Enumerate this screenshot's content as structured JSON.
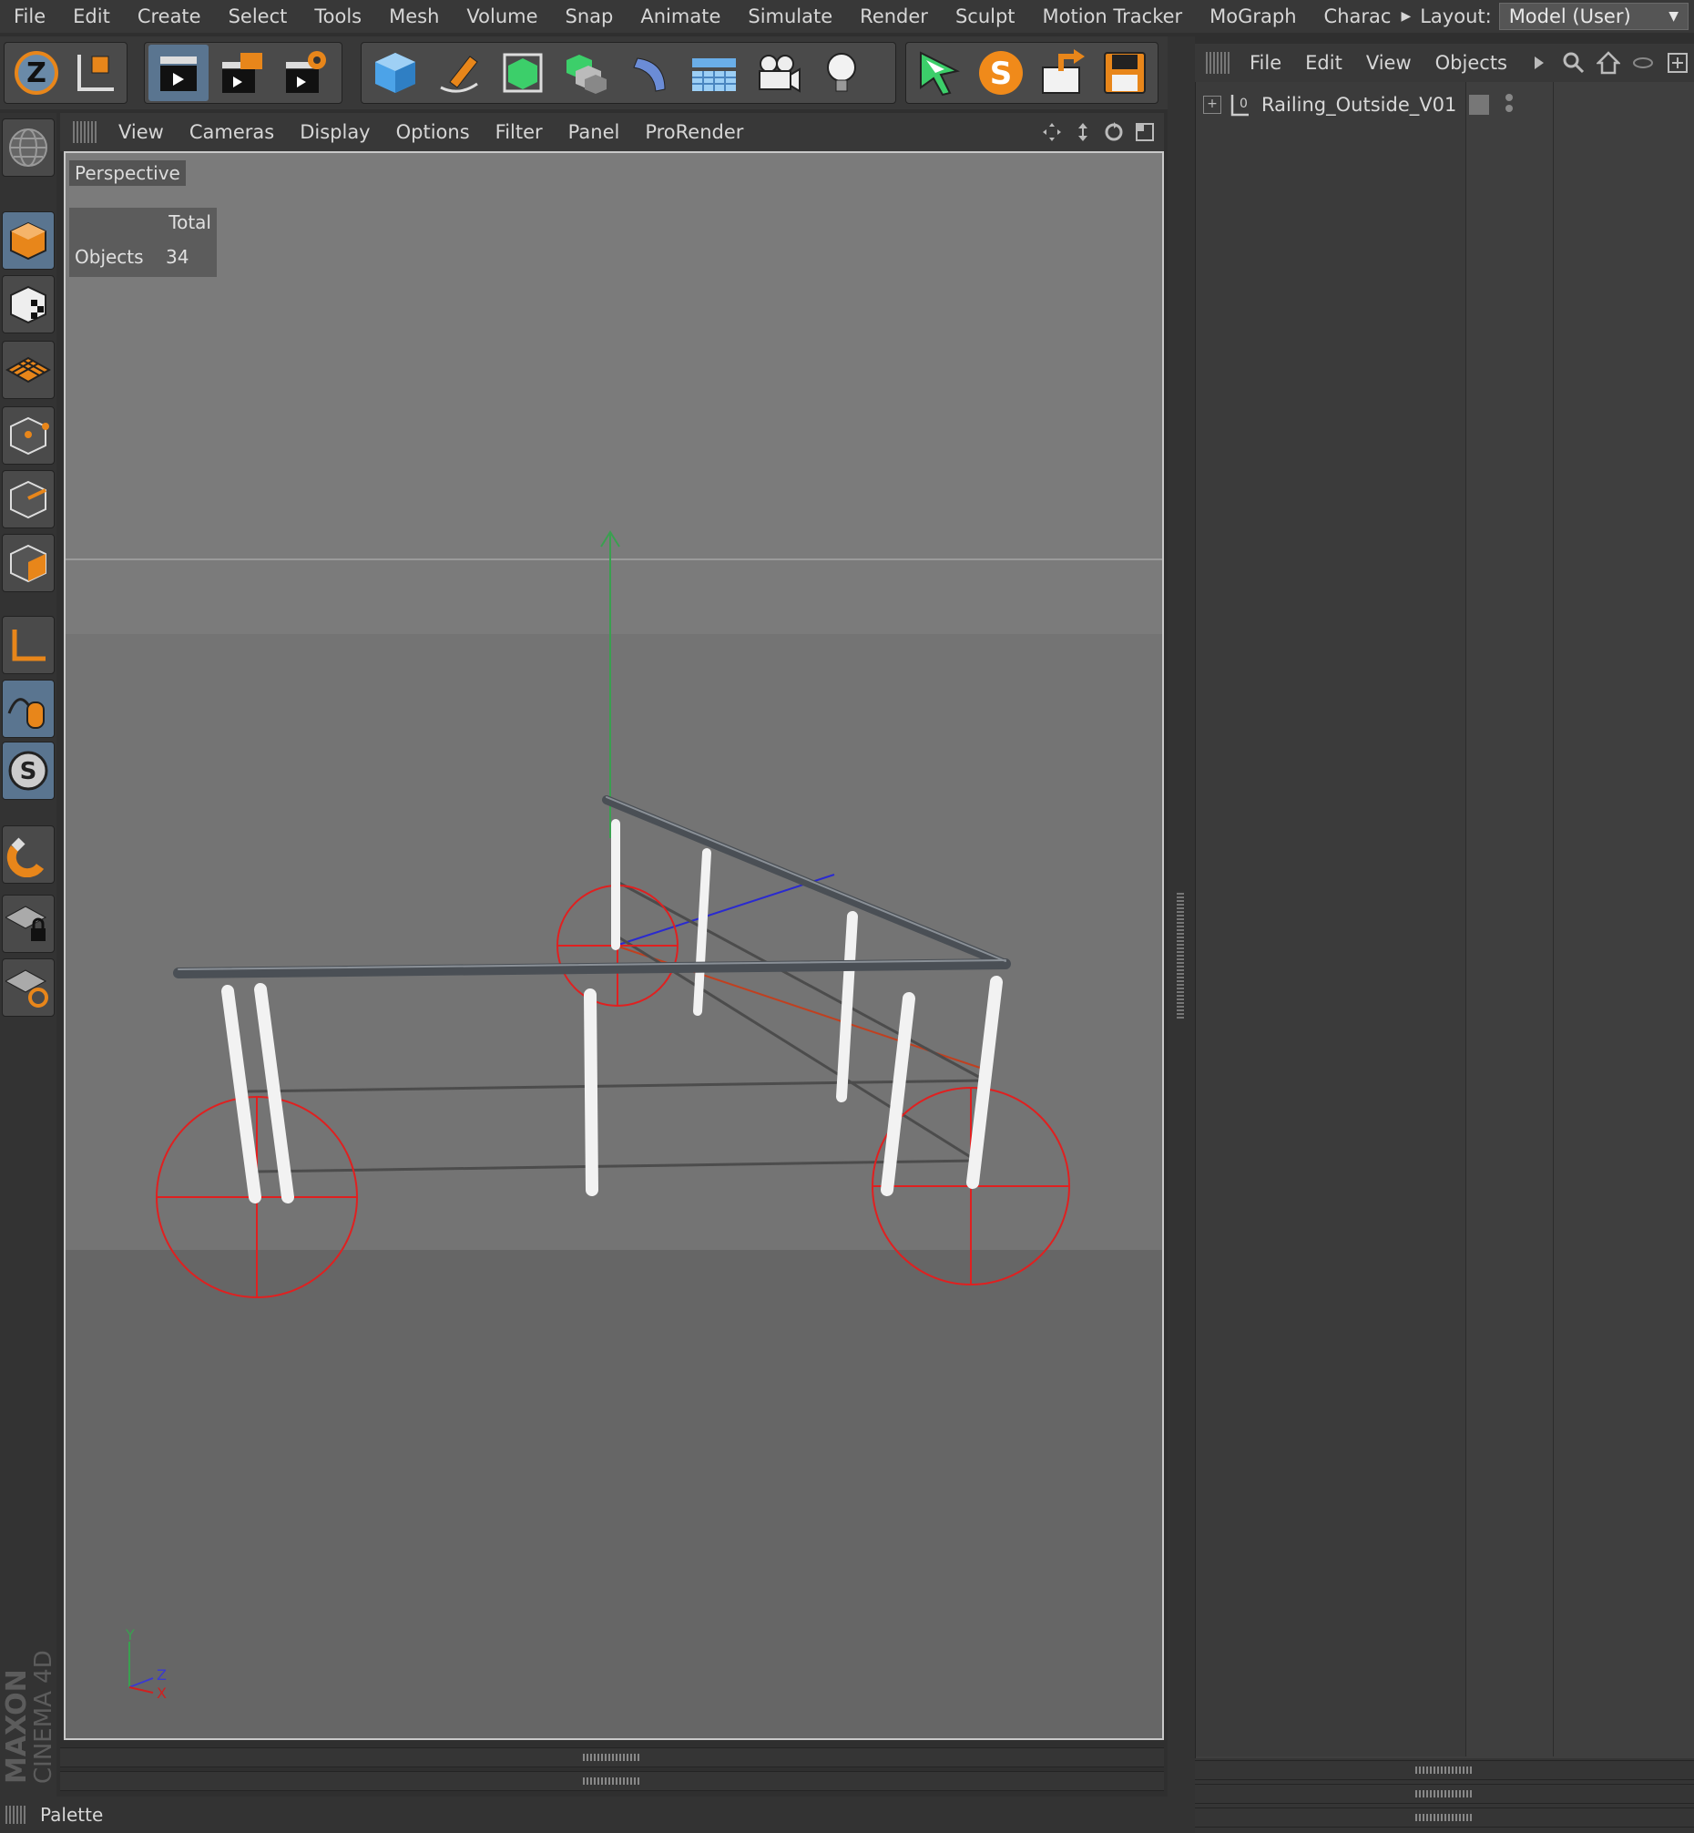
{
  "main_menu": {
    "items": [
      "File",
      "Edit",
      "Create",
      "Select",
      "Tools",
      "Mesh",
      "Volume",
      "Snap",
      "Animate",
      "Simulate",
      "Render",
      "Sculpt",
      "Motion Tracker",
      "MoGraph",
      "Charac"
    ],
    "layout_label": "Layout:",
    "layout_value": "Model (User)"
  },
  "toolbar": {
    "buttons": [
      "undo",
      "live-selection",
      "render-view",
      "render-to-picture-viewer",
      "render-settings",
      "cube",
      "pen",
      "subdivision-surface",
      "array",
      "deformer",
      "floor",
      "camera",
      "light",
      "snap-move",
      "sketch",
      "open",
      "save"
    ]
  },
  "left_toolbar": {
    "buttons": [
      "globe",
      "model-mode",
      "texture-mode",
      "workplane-mode",
      "points-mode",
      "edges-mode",
      "polygons-mode",
      "axis-mode",
      "tweak-mode",
      "solo-mode",
      "snap-mode",
      "locked-workplane",
      "planar-workplane"
    ]
  },
  "viewport": {
    "menu": [
      "View",
      "Cameras",
      "Display",
      "Options",
      "Filter",
      "Panel",
      "ProRender"
    ],
    "camera_label": "Perspective",
    "hud": {
      "total_label": "Total",
      "objects_label": "Objects",
      "objects_count": "34"
    },
    "axis_labels": {
      "y": "Y",
      "z": "Z",
      "x": "X"
    }
  },
  "object_manager": {
    "menu": [
      "File",
      "Edit",
      "View",
      "Objects"
    ],
    "objects": [
      {
        "name": "Railing_Outside_V01",
        "layer": "0"
      }
    ]
  },
  "branding": {
    "maker": "MAXON",
    "product": "CINEMA 4D"
  },
  "palette": {
    "label": "Palette"
  },
  "colors": {
    "accent": "#e8861a",
    "selection_blue": "#5a7590",
    "null_red": "#e02020"
  }
}
